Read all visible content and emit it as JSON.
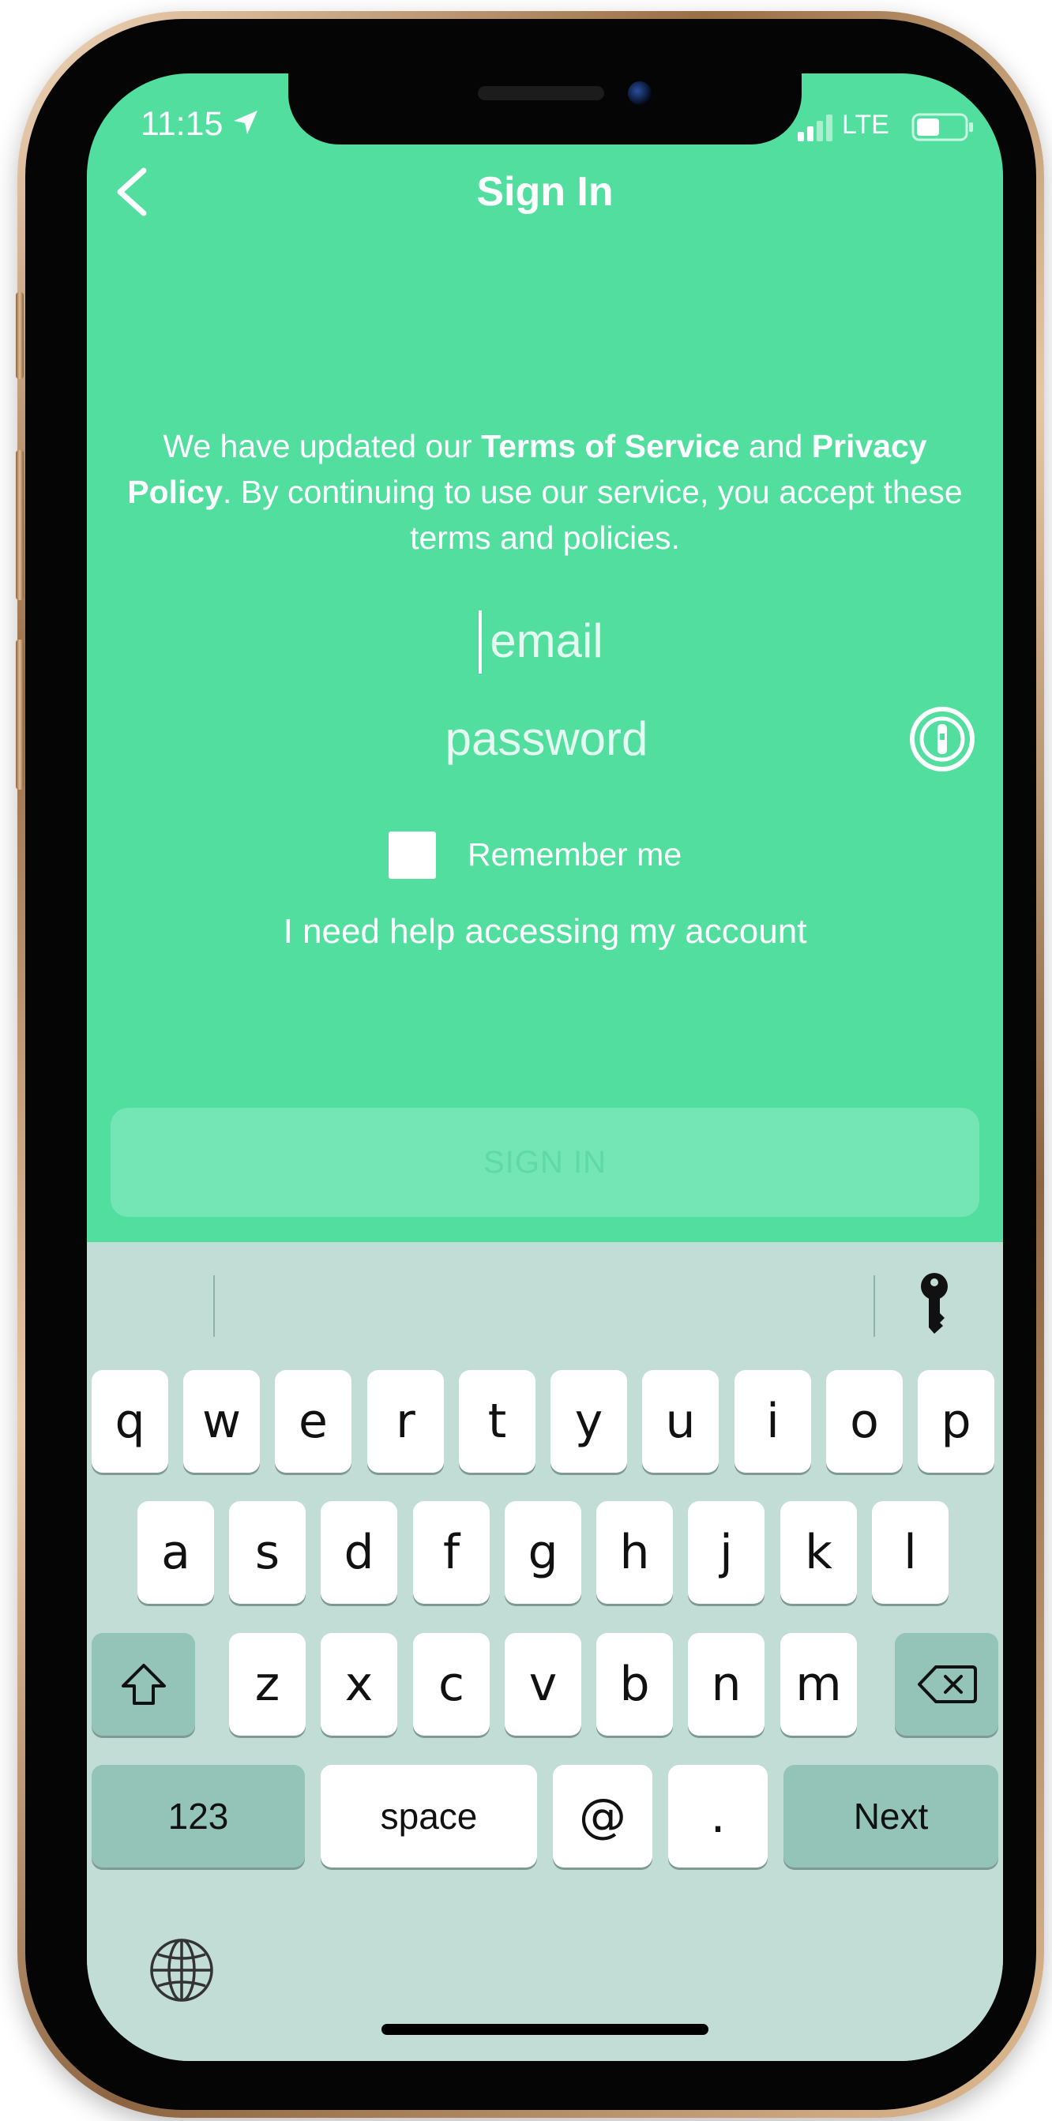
{
  "status_bar": {
    "time": "11:15",
    "network": "LTE"
  },
  "nav": {
    "title": "Sign In"
  },
  "terms": {
    "pre": "We have updated our ",
    "tos": "Terms of Service",
    "mid": " and ",
    "privacy": "Privacy Policy",
    "post": ". By continuing to use our service, you accept these terms and policies."
  },
  "form": {
    "email_placeholder": "email",
    "password_placeholder": "password",
    "remember_label": "Remember me",
    "help_link": "I need help accessing my account",
    "signin_label": "SIGN IN"
  },
  "keyboard": {
    "row1": [
      "q",
      "w",
      "e",
      "r",
      "t",
      "y",
      "u",
      "i",
      "o",
      "p"
    ],
    "row2": [
      "a",
      "s",
      "d",
      "f",
      "g",
      "h",
      "j",
      "k",
      "l"
    ],
    "row3": [
      "z",
      "x",
      "c",
      "v",
      "b",
      "n",
      "m"
    ],
    "numbers_label": "123",
    "space_label": "space",
    "at_label": "@",
    "period_label": ".",
    "next_label": "Next"
  },
  "icons": {
    "back": "chevron-left-icon",
    "location": "location-arrow-icon",
    "signal": "signal-bars-icon",
    "battery": "battery-icon",
    "password_manager": "onepassword-icon",
    "keychain": "key-icon",
    "shift": "shift-icon",
    "delete": "backspace-icon",
    "globe": "globe-icon"
  },
  "colors": {
    "brand_green": "#52de9f",
    "button_disabled": "#74e5b5",
    "keyboard_bg": "#c2ddd6",
    "key_dark": "#94c4b8"
  }
}
